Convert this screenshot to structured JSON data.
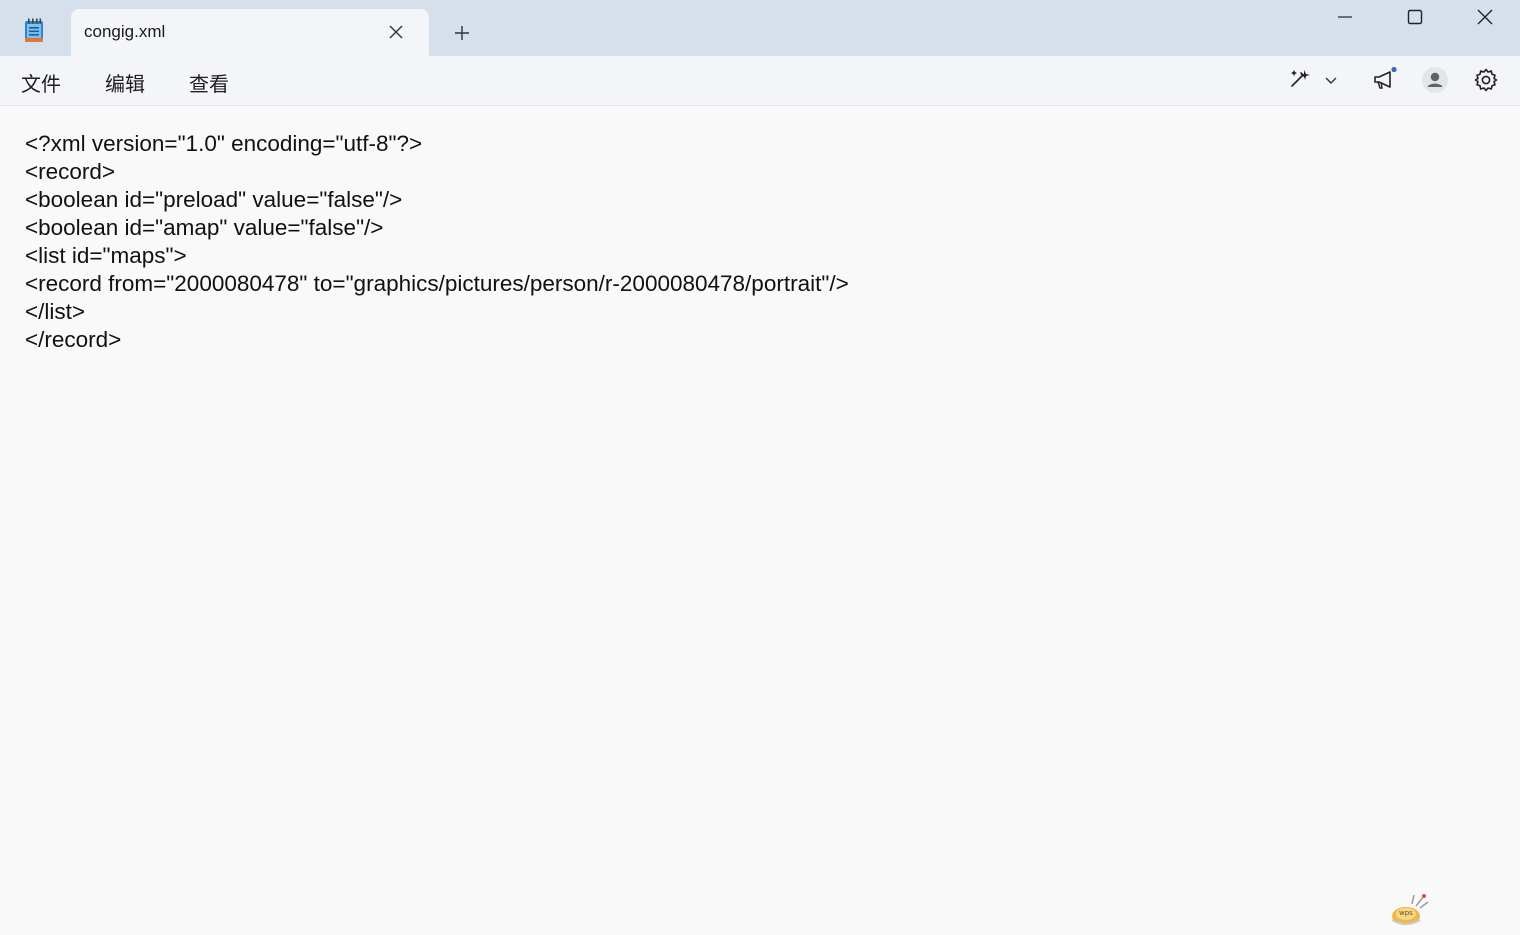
{
  "tab": {
    "title": "congig.xml",
    "close_icon": "close-icon",
    "new_tab_icon": "plus-icon"
  },
  "window_controls": [
    "minimize-icon",
    "maximize-icon",
    "close-icon"
  ],
  "menu": {
    "file": "文件",
    "edit": "编辑",
    "view": "查看"
  },
  "toolbar": {
    "copilot_icon": "copilot-icon",
    "dropdown_icon": "chevron-down-icon",
    "announce_icon": "megaphone-icon",
    "account_icon": "account-icon",
    "settings_icon": "gear-icon"
  },
  "document": {
    "lines": [
      "<?xml version=\"1.0\" encoding=\"utf-8\"?>",
      "<record>",
      "<boolean id=\"preload\" value=\"false\"/>",
      "<boolean id=\"amap\" value=\"false\"/>",
      "<list id=\"maps\">",
      "<record from=\"2000080478\" to=\"graphics/pictures/person/r-2000080478/portrait\"/>",
      "</list>",
      "</record>"
    ]
  },
  "colors": {
    "titlebar": "#d5e0ec",
    "tab_active": "#f3f5f8",
    "editor_bg": "#f9f9f9",
    "notepad_icon": "#2f86c9"
  },
  "tray": {
    "logo_icon": "watermark-logo-icon",
    "text": "wps"
  }
}
